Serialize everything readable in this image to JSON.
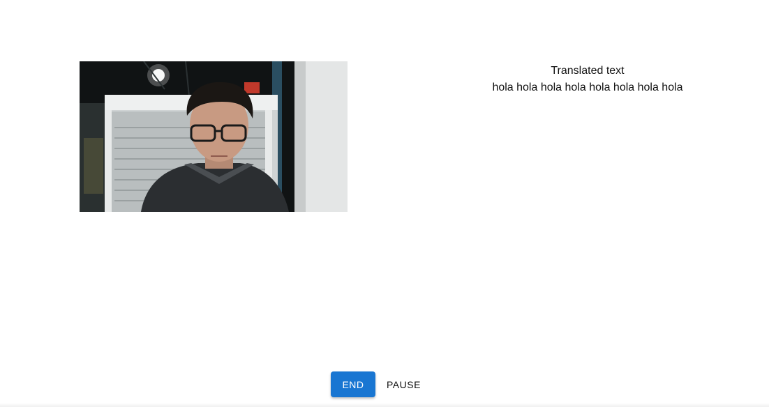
{
  "translation": {
    "heading": "Translated text",
    "text": "hola hola hola hola hola hola hola hola"
  },
  "controls": {
    "end_label": "END",
    "pause_label": "PAUSE"
  },
  "colors": {
    "primary": "#1976d2"
  }
}
